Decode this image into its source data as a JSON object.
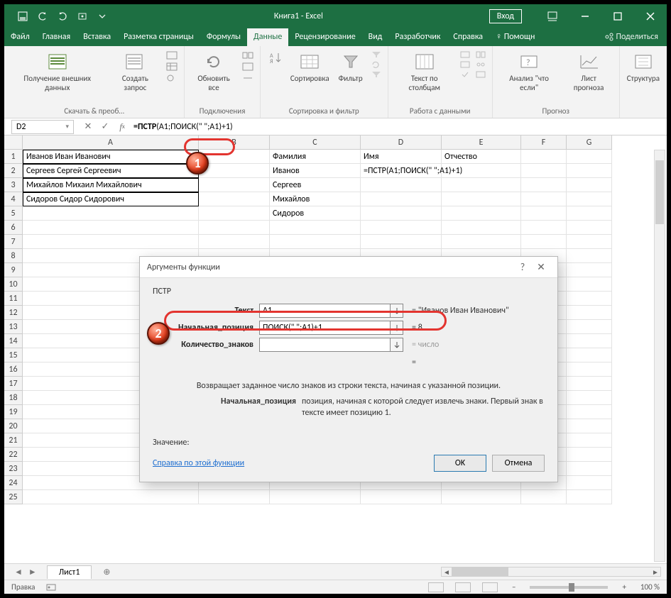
{
  "title": "Книга1  -  Excel",
  "login": "Вход",
  "tabs": [
    "Файл",
    "Главная",
    "Вставка",
    "Разметка страницы",
    "Формулы",
    "Данные",
    "Рецензирование",
    "Вид",
    "Разработчик",
    "Справка",
    "Помощн"
  ],
  "active_tab_index": 5,
  "share": "Поделиться",
  "ribbon": {
    "groups": [
      {
        "label": "Скачать & преоб…",
        "buttons": [
          {
            "label": "Получение\nвнешних данных"
          },
          {
            "label": "Создать\nзапрос"
          }
        ]
      },
      {
        "label": "Подключения",
        "buttons": [
          {
            "label": "Обновить\nвсе"
          }
        ]
      },
      {
        "label": "Сортировка и фильтр",
        "buttons": [
          {
            "label": "Сортировка"
          },
          {
            "label": "Фильтр"
          }
        ]
      },
      {
        "label": "Работа с данными",
        "buttons": [
          {
            "label": "Текст по\nстолбцам"
          }
        ]
      },
      {
        "label": "Прогноз",
        "buttons": [
          {
            "label": "Анализ \"что\nесли\""
          },
          {
            "label": "Лист\nпрогноза"
          }
        ]
      },
      {
        "label": "",
        "buttons": [
          {
            "label": "Структура"
          }
        ]
      }
    ]
  },
  "namebox": "D2",
  "formula": "=ПСТР(A1;ПОИСК(\" \";A1)+1)",
  "formula_prefix": "=ПСТР",
  "formula_rest": "(A1;ПОИСК(\" \";A1)+1)",
  "columns": [
    "A",
    "B",
    "C",
    "D",
    "E",
    "F",
    "G"
  ],
  "cells": {
    "A1": "Иванов Иван Иванович",
    "A2": "Сергеев Сергей Сергеевич",
    "A3": "Михайлов Михаил Михайлович",
    "A4": "Сидоров Сидор Сидорович",
    "C1": "Фамилия",
    "C2": "Иванов",
    "C3": "Сергеев",
    "C4": "Михайлов",
    "C5": "Сидоров",
    "D1": "Имя",
    "D2": "=ПСТР(A1;ПОИСК(\" \";A1)+1)",
    "E1": "Отчество"
  },
  "row_count": 25,
  "dialog": {
    "title": "Аргументы функции",
    "fn": "ПСТР",
    "args": [
      {
        "label": "Текст",
        "value": "A1",
        "result": "=   \"Иванов Иван Иванович\"",
        "gray": false
      },
      {
        "label": "Начальная_позиция",
        "value": "ПОИСК(\" \";A1)+1",
        "result": "=   8",
        "gray": false
      },
      {
        "label": "Количество_знаков",
        "value": "",
        "result": "=   число",
        "gray": true
      }
    ],
    "eq_line": "=",
    "description": "Возвращает заданное число знаков из строки текста, начиная с указанной позиции.",
    "arg_help_label": "Начальная_позиция",
    "arg_help_text": "позиция, начиная с которой следует извлечь знаки. Первый знак в тексте имеет позицию 1.",
    "value_label": "Значение:",
    "help_link": "Справка по этой функции",
    "ok": "OK",
    "cancel": "Отмена"
  },
  "sheet_tab": "Лист1",
  "status": "Правка",
  "zoom": "100 %"
}
